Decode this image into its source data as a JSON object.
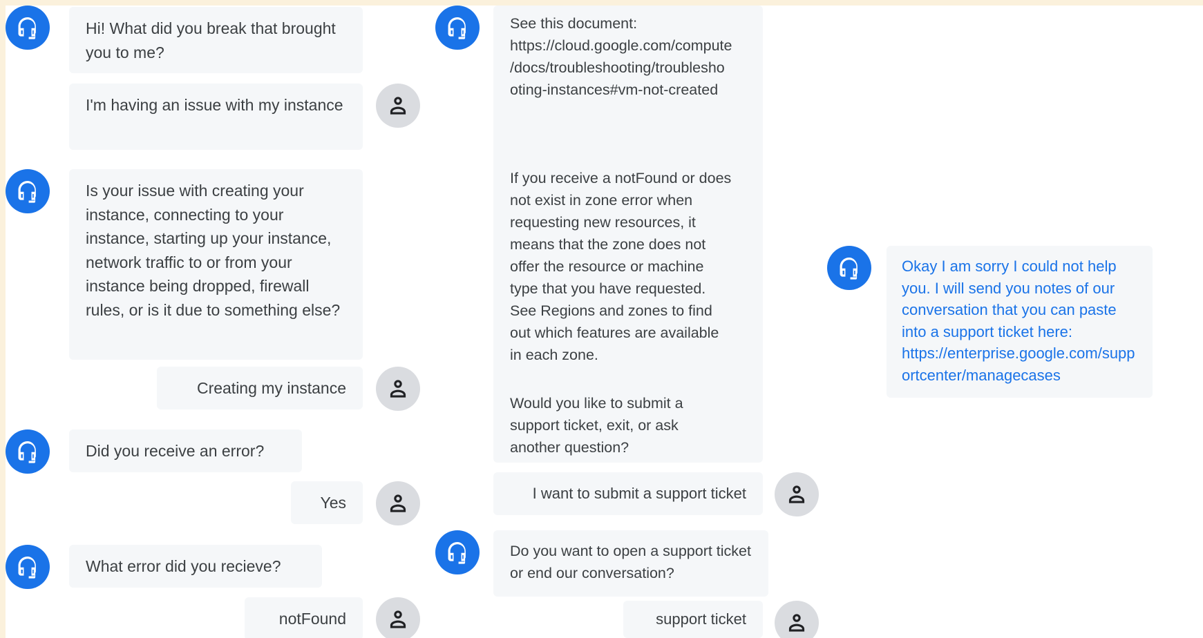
{
  "colors": {
    "bot_avatar": "#1a73e8",
    "user_avatar": "#dadce0",
    "bubble_bg": "#f5f7f9",
    "text": "#3c4043",
    "link_text": "#1a73e8",
    "frame": "#fbf1dc"
  },
  "icons": {
    "bot": "headset-icon",
    "user": "person-icon"
  },
  "column1": {
    "bot_greeting": "Hi! What did you break that brought you to me?",
    "user_issue": "I'm having an issue with my instance",
    "bot_issue_type": "Is your issue with creating your instance, connecting to your instance, starting up your instance, network traffic to or from your instance being dropped, firewall rules, or is it due to something else?",
    "user_creating": "Creating my instance",
    "bot_error_q": "Did you receive an error?",
    "user_yes": "Yes",
    "bot_which_error": "What error did you recieve?",
    "user_notfound": "notFound"
  },
  "column2": {
    "bot_doc_link": "See this document: https://cloud.google.com/compute/docs/troubleshooting/troubleshooting-instances#vm-not-created",
    "bot_doc_explain": "If you receive a notFound or does not exist in zone error when requesting new resources, it means that the zone does not offer the resource or machine type that you have requested. See Regions and zones to find out which features are available in each zone.",
    "bot_doc_question": "Would you like to submit a support ticket, exit, or ask another question?",
    "user_submit": "I want to submit a support ticket",
    "bot_open_or_end": "Do you want to open a support ticket or end our conversation?",
    "user_ticket": "support ticket"
  },
  "column3": {
    "bot_sorry": "Okay I am sorry I could not help you. I will send you notes of our conversation that you can paste into a support ticket here: https://enterprise.google.com/supportcenter/managecases"
  }
}
